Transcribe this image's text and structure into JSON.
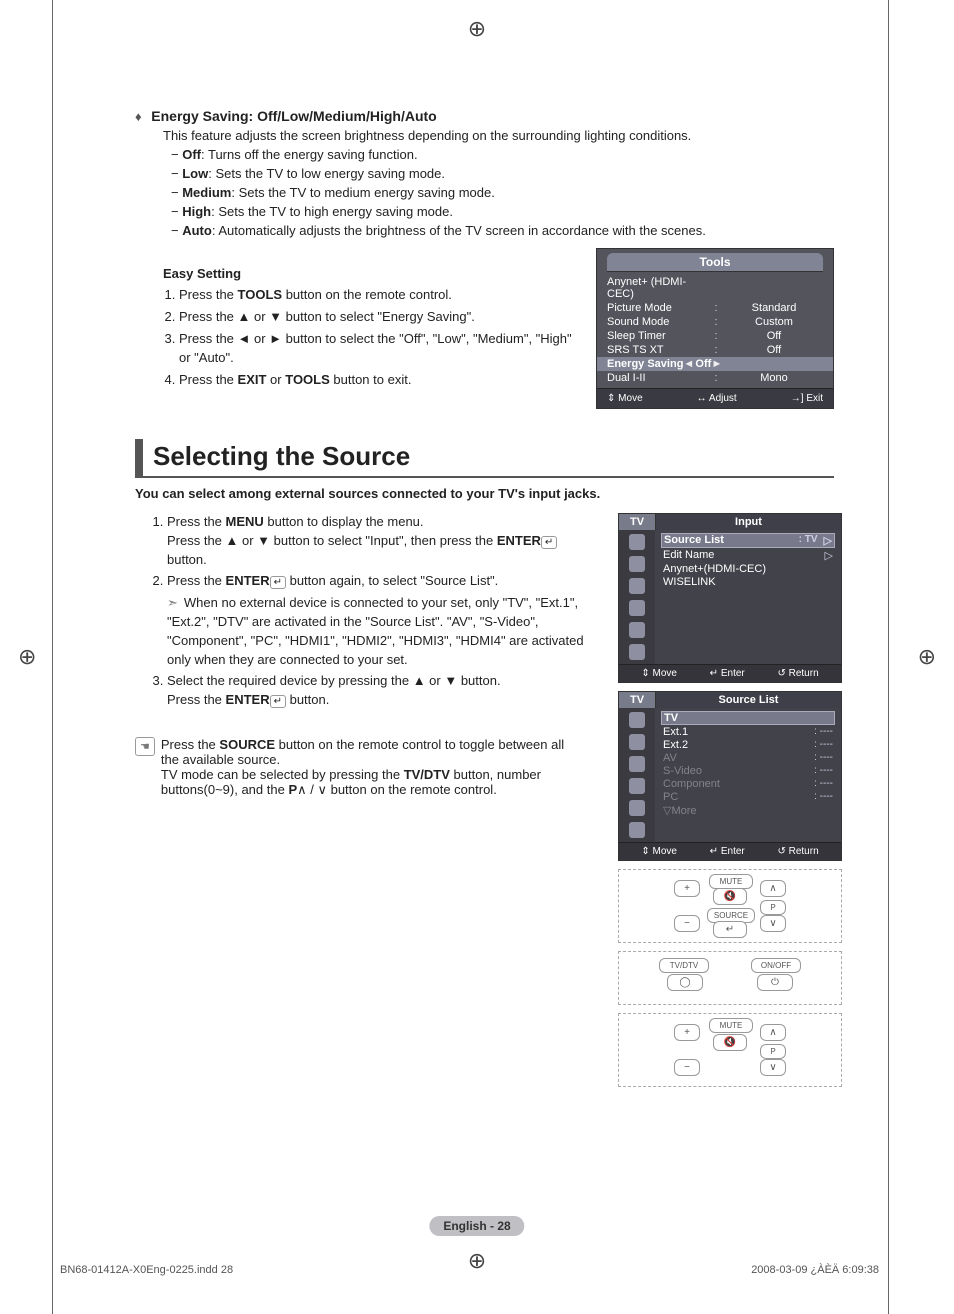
{
  "energy": {
    "heading": "Energy Saving: Off/Low/Medium/High/Auto",
    "desc": "This feature adjusts the screen brightness depending on the surrounding lighting conditions.",
    "items": [
      {
        "label": "Off",
        "text": ": Turns off the energy saving function."
      },
      {
        "label": "Low",
        "text": ": Sets the TV to low energy saving mode."
      },
      {
        "label": "Medium",
        "text": ": Sets the TV to medium energy saving mode."
      },
      {
        "label": "High",
        "text": ": Sets the TV to high energy saving mode."
      },
      {
        "label": "Auto",
        "text": ": Automatically adjusts the brightness of the TV screen in accordance with the scenes."
      }
    ]
  },
  "easy": {
    "title": "Easy Setting",
    "s1a": "Press the ",
    "s1b": "TOOLS",
    "s1c": " button on the remote control.",
    "s2": "Press the ▲ or ▼ button to select \"Energy Saving\".",
    "s3": "Press the ◄ or ► button to select the \"Off\", \"Low\", \"Medium\", \"High\" or \"Auto\".",
    "s4a": "Press the ",
    "s4b": "EXIT",
    "s4c": " or ",
    "s4d": "TOOLS",
    "s4e": " button to exit."
  },
  "tools": {
    "title": "Tools",
    "rows": [
      {
        "label": "Anynet+ (HDMI-CEC)",
        "value": ""
      },
      {
        "label": "Picture Mode",
        "value": "Standard"
      },
      {
        "label": "Sound Mode",
        "value": "Custom"
      },
      {
        "label": "Sleep Timer",
        "value": "Off"
      },
      {
        "label": "SRS TS XT",
        "value": "Off"
      }
    ],
    "sel": {
      "label": "Energy Saving",
      "value": "Off"
    },
    "after": {
      "label": "Dual I-II",
      "value": "Mono"
    },
    "foot": {
      "move": "Move",
      "adjust": "Adjust",
      "exit": "Exit"
    }
  },
  "section": {
    "title": "Selecting the Source",
    "sub": "You can select among external sources connected to your TV's input jacks.",
    "step1": {
      "a": "Press the ",
      "b": "MENU",
      "c": " button to display the menu.",
      "d": "Press the ▲ or ▼ button to select \"Input\", then press the ",
      "e": "ENTER",
      "f": " button."
    },
    "step2": {
      "a": "Press the ",
      "b": "ENTER",
      "c": " button again, to select \"Source List\"."
    },
    "step2note": "When no external device is connected to your set, only \"TV\", \"Ext.1\", \"Ext.2\", \"DTV\" are activated in the \"Source List\". \"AV\", \"S-Video\", \"Component\", \"PC\", \"HDMI1\", \"HDMI2\", \"HDMI3\", \"HDMI4\" are activated only when they are connected to your set.",
    "step3": {
      "a": "Select the required device by pressing the ▲ or ▼ button.",
      "b": "Press the ",
      "c": "ENTER",
      "d": " button."
    }
  },
  "tip": {
    "a": "Press the ",
    "b": "SOURCE",
    "c": " button on the remote control to toggle between all the available source.",
    "d": "TV mode can be selected by pressing the ",
    "e": "TV/DTV",
    "f": " button, number buttons(0~9), and the ",
    "g": "P",
    "h": " button on the remote control."
  },
  "osd_input": {
    "tv": "TV",
    "title": "Input",
    "rows": [
      {
        "label": "Source List",
        "value": ": TV",
        "sel": true,
        "chev": "▷"
      },
      {
        "label": "Edit Name",
        "value": "",
        "chev": "▷"
      },
      {
        "label": "Anynet+(HDMI-CEC)",
        "value": ""
      },
      {
        "label": "WISELINK",
        "value": ""
      }
    ],
    "foot": {
      "move": "Move",
      "enter": "Enter",
      "return": "Return"
    }
  },
  "osd_source": {
    "tv": "TV",
    "title": "Source List",
    "rows": [
      {
        "label": "TV",
        "value": "",
        "sel": true
      },
      {
        "label": "Ext.1",
        "value": ": ----"
      },
      {
        "label": "Ext.2",
        "value": ": ----"
      },
      {
        "label": "AV",
        "value": ": ----",
        "dim": true
      },
      {
        "label": "S-Video",
        "value": ": ----",
        "dim": true
      },
      {
        "label": "Component",
        "value": ": ----",
        "dim": true
      },
      {
        "label": "PC",
        "value": ": ----",
        "dim": true
      },
      {
        "label": "▽More",
        "value": "",
        "dim": true
      }
    ],
    "foot": {
      "move": "Move",
      "enter": "Enter",
      "return": "Return"
    }
  },
  "remote": {
    "r1": {
      "mute": "MUTE",
      "source": "SOURCE",
      "p": "P"
    },
    "r2": {
      "tvdtv": "TV/DTV",
      "onoff": "ON/OFF"
    },
    "r3": {
      "mute": "MUTE",
      "p": "P"
    }
  },
  "footer": "English - 28",
  "meta": {
    "left": "BN68-01412A-X0Eng-0225.indd   28",
    "right": "2008-03-09   ¿ÀÈÄ 6:09:38"
  },
  "arrows": {
    "updown": "⇕",
    "leftright": "↔"
  }
}
